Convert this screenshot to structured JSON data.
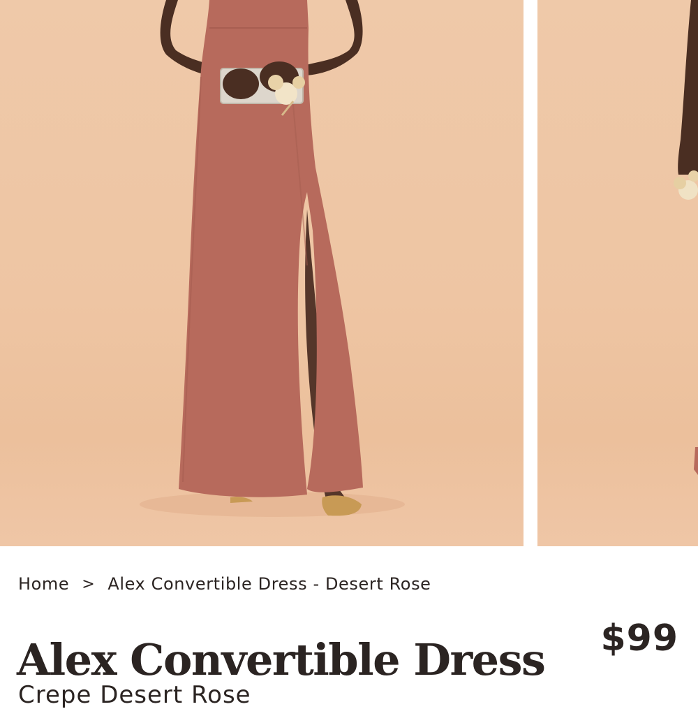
{
  "breadcrumb": {
    "home": "Home",
    "separator": ">",
    "current": "Alex Convertible Dress - Desert Rose"
  },
  "product": {
    "name": "Alex Convertible Dress",
    "price": "$99",
    "variant": "Crepe Desert Rose"
  },
  "colors": {
    "dress": "#b76a5c",
    "backdrop": "#eec5a3",
    "text": "#2b2422"
  }
}
